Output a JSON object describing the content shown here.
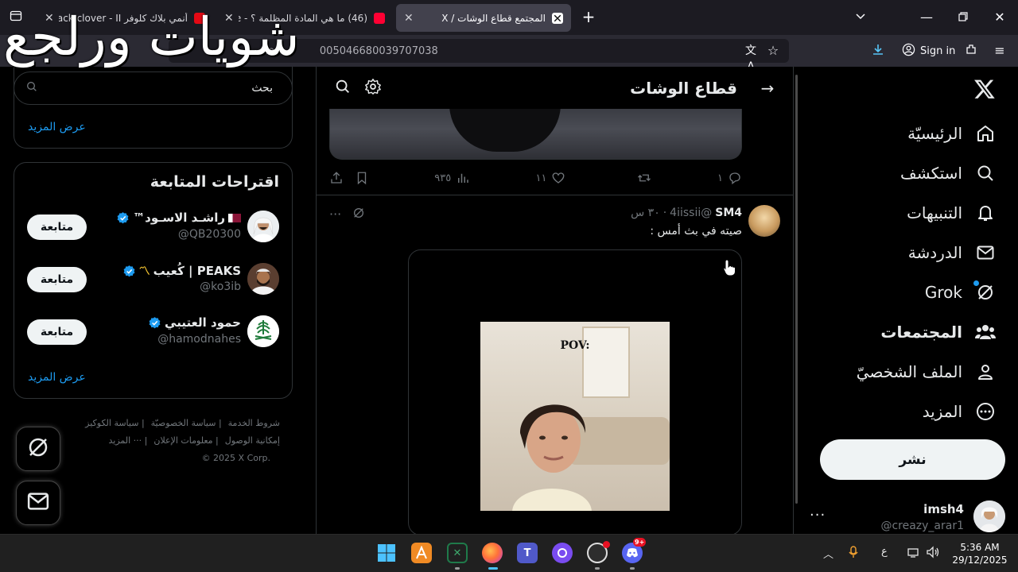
{
  "browser": {
    "tabs": [
      {
        "title": "أنمي بلاك كلوفر Black clover - II",
        "active": false,
        "icon_color": "#e50914"
      },
      {
        "title": "(46) ما هي المادة المظلمة ؟ - e",
        "active": false,
        "icon_color": "#ff0033"
      },
      {
        "title": "المجتمع قطاع الوشات / X",
        "active": true,
        "icon_color": "#000000"
      }
    ],
    "new_tab": "+",
    "url": "005046680039707038",
    "url_prefix": "com",
    "sign_in": "Sign in",
    "overlay_caption": "شويات ورلجع"
  },
  "nav": {
    "items": [
      {
        "label": "الرئيسيّة",
        "icon": "home-icon",
        "bold": false
      },
      {
        "label": "استكشف",
        "icon": "search-icon",
        "bold": false
      },
      {
        "label": "التنبيهات",
        "icon": "bell-icon",
        "bold": false
      },
      {
        "label": "الدردشة",
        "icon": "mail-icon",
        "bold": false
      },
      {
        "label": "Grok",
        "icon": "grok-icon",
        "bold": false
      },
      {
        "label": "المجتمعات",
        "icon": "communities-icon",
        "bold": true
      },
      {
        "label": "الملف الشخصيّ",
        "icon": "profile-icon",
        "bold": false
      },
      {
        "label": "المزيد",
        "icon": "more-icon",
        "bold": false
      }
    ],
    "post_button": "نشر",
    "account": {
      "name": "imsh4",
      "handle": "@creazy_arar1",
      "more": "···"
    }
  },
  "center": {
    "title": "قطاع الوشات",
    "actions": {
      "replies": "١",
      "reposts": "",
      "likes": "١١",
      "views": "٩٣٥"
    },
    "post": {
      "name": "SM4",
      "handle": "@4iissii",
      "time": "٣٠ س",
      "text": "صيته في بث أمس :",
      "video_caption": "POV:"
    }
  },
  "left": {
    "search_placeholder": "بحث",
    "show_more": "عرض المزيد",
    "suggestions_title": "اقتراحات المتابعة",
    "suggestions": [
      {
        "name": "راشـد الاسـود™",
        "handle": "@QB20300",
        "flag": "qatar-flag-icon",
        "follow": "متابعة"
      },
      {
        "name": "PEAKS | كُعيب",
        "handle": "@ko3ib",
        "flag": "wave-icon",
        "follow": "متابعة"
      },
      {
        "name": "حمود العتيبي",
        "handle": "@hamodnahes",
        "flag": "",
        "follow": "متابعة"
      }
    ],
    "show_more_2": "عرض المزيد",
    "footer": {
      "row1": [
        "شروط الخدمة",
        "سياسة الخصوصيّة",
        "سياسة الكوكيز"
      ],
      "row2": [
        "إمكانية الوصول",
        "معلومات الإعلان",
        "··· المزيد"
      ],
      "row3": "© 2025 X Corp."
    }
  },
  "taskbar": {
    "time": "5:36 AM",
    "date": "29/12/2025",
    "lang": "ع",
    "discord_badge": "9+"
  },
  "colors": {
    "accent": "#1d9bf0",
    "background": "#000000",
    "border": "#2f3336"
  }
}
